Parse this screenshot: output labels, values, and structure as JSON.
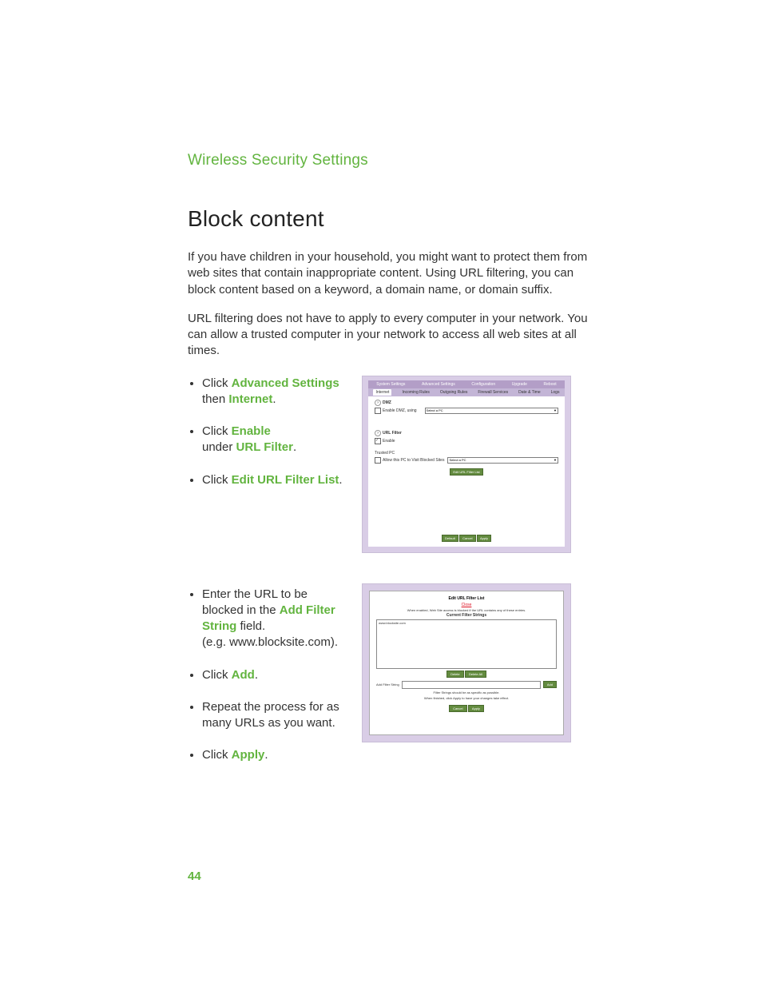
{
  "page_number": "44",
  "section_heading": "Wireless Security Settings",
  "main_heading": "Block content",
  "paragraphs": {
    "p1": "If you have children in your household, you might want to protect them from web sites that contain inappropriate content. Using URL filtering, you can block content based on a keyword, a domain name, or domain suffix.",
    "p2": "URL filtering does not have to apply to every computer in your network. You can allow a trusted computer in your network to access all web sites at all times."
  },
  "steps_block1": {
    "s1": {
      "prefix": "Click ",
      "bold1": "Advanced Settings",
      "mid": " then ",
      "bold2": "Internet",
      "suffix": "."
    },
    "s2": {
      "prefix": "Click ",
      "bold1": "Enable",
      "mid": " under ",
      "bold2": "URL Filter",
      "suffix": "."
    },
    "s3": {
      "prefix": "Click ",
      "bold1": "Edit URL Filter List",
      "suffix": "."
    }
  },
  "steps_block2": {
    "s1": {
      "prefix": "Enter the URL to be blocked in the ",
      "bold1": "Add Filter String",
      "suffix": " field.",
      "example": "(e.g. www.blocksite.com)."
    },
    "s2": {
      "prefix": "Click ",
      "bold1": "Add",
      "suffix": "."
    },
    "s3": {
      "text": "Repeat the process for as many URLs as you want."
    },
    "s4": {
      "prefix": "Click ",
      "bold1": "Apply",
      "suffix": "."
    }
  },
  "shot1": {
    "top_tabs": {
      "t1": "System Settings",
      "t2": "Advanced Settings",
      "t3": "Configuration",
      "t4": "Upgrade",
      "t5": "Reboot"
    },
    "sub_tabs": {
      "t1": "Internet",
      "t2": "Incoming Rules",
      "t3": "Outgoing Rules",
      "t4": "Firewall Services",
      "t5": "Date & Time",
      "t6": "Logs"
    },
    "dmz_label": "DMZ",
    "dmz_enable": "Enable DMZ, using",
    "select_pc": "Select a PC",
    "url_filter_label": "URL Filter",
    "enable_label": "Enable",
    "trusted_pc_label": "Trusted PC",
    "allow_label": "Allow this PC to Visit Blocked Sites",
    "edit_button": "Edit URL Filter List",
    "buttons": {
      "b1": "Default",
      "b2": "Cancel",
      "b3": "Apply"
    }
  },
  "shot2": {
    "title": "Edit URL Filter List",
    "close": "Close",
    "note": "When enabled, Web Site access is blocked if the URL contains any of these entries.",
    "sub": "Current Filter Strings",
    "listbox_item": "www.blocksite.com",
    "buttons_mid": {
      "b1": "Delete",
      "b2": "Delete All"
    },
    "add_label": "Add Filter String",
    "add_button": "Add",
    "hint1": "Filter Strings should be as specific as possible.",
    "hint2": "When finished, click Apply to have your changes take effect.",
    "buttons_bottom": {
      "b1": "Cancel",
      "b2": "Apply"
    }
  }
}
